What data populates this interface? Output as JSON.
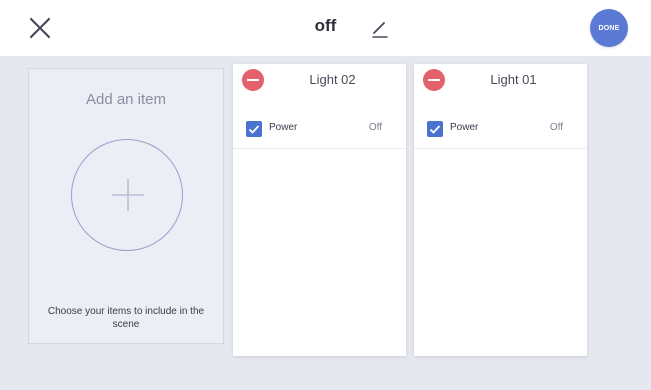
{
  "header": {
    "title": "off",
    "done_label": "DONE",
    "close_icon": "close-icon",
    "edit_icon": "pencil-icon",
    "accent_color": "#5a7ad6"
  },
  "add_item": {
    "title": "Add an item",
    "caption": "Choose your items to include in the scene",
    "icon": "plus-icon"
  },
  "items": [
    {
      "name": "Light 02",
      "remove_icon": "remove-icon",
      "row": {
        "label": "Power",
        "value": "Off",
        "checked": true
      }
    },
    {
      "name": "Light 01",
      "remove_icon": "remove-icon",
      "row": {
        "label": "Power",
        "value": "Off",
        "checked": true
      }
    }
  ],
  "colors": {
    "remove": "#e2616a",
    "checkbox": "#4a72cf",
    "background": "#e6e8f0"
  }
}
